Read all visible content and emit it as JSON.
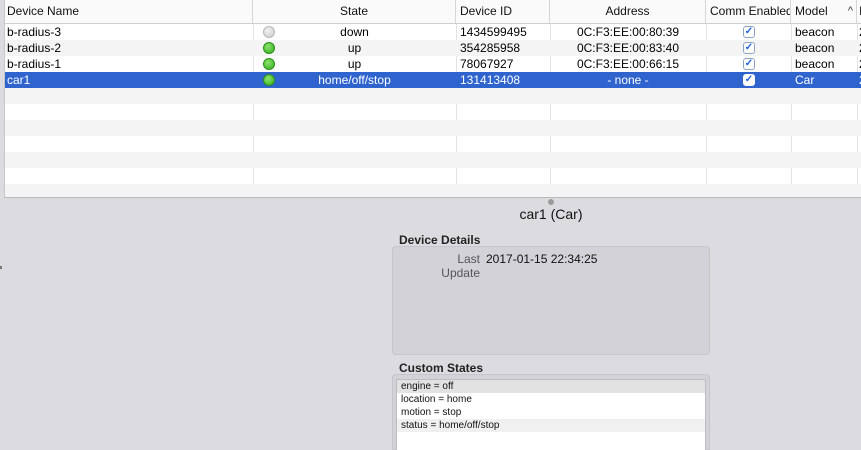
{
  "table": {
    "columns": {
      "name": "Device Name",
      "state": "State",
      "id": "Device ID",
      "address": "Address",
      "comm": "Comm Enabled",
      "model": "Model",
      "sort_indicator": "^",
      "extra": "I"
    },
    "rows": [
      {
        "name": "b-radius-3",
        "state": "down",
        "status_color": "grey",
        "id": "1434599495",
        "address": "0C:F3:EE:00:80:39",
        "comm": true,
        "model": "beacon",
        "extra": "2"
      },
      {
        "name": "b-radius-2",
        "state": "up",
        "status_color": "green",
        "id": "354285958",
        "address": "0C:F3:EE:00:83:40",
        "comm": true,
        "model": "beacon",
        "extra": "2"
      },
      {
        "name": "b-radius-1",
        "state": "up",
        "status_color": "green",
        "id": "78067927",
        "address": "0C:F3:EE:00:66:15",
        "comm": true,
        "model": "beacon",
        "extra": "2"
      },
      {
        "name": "car1",
        "state": "home/off/stop",
        "status_color": "green",
        "id": "131413408",
        "address": "- none -",
        "comm": true,
        "model": "Car",
        "extra": "2",
        "selected": true
      }
    ],
    "colors": {
      "selection": "#2f64cf",
      "status_up": "#2fae1c",
      "status_down": "#c9c9c9"
    }
  },
  "detail": {
    "title": "car1 (Car)",
    "device_details_label": "Device Details",
    "last_update_key": "Last Update",
    "last_update_value": "2017-01-15 22:34:25",
    "custom_states_label": "Custom States",
    "custom_states": [
      "engine = off",
      "location = home",
      "motion = stop",
      "status = home/off/stop"
    ]
  }
}
